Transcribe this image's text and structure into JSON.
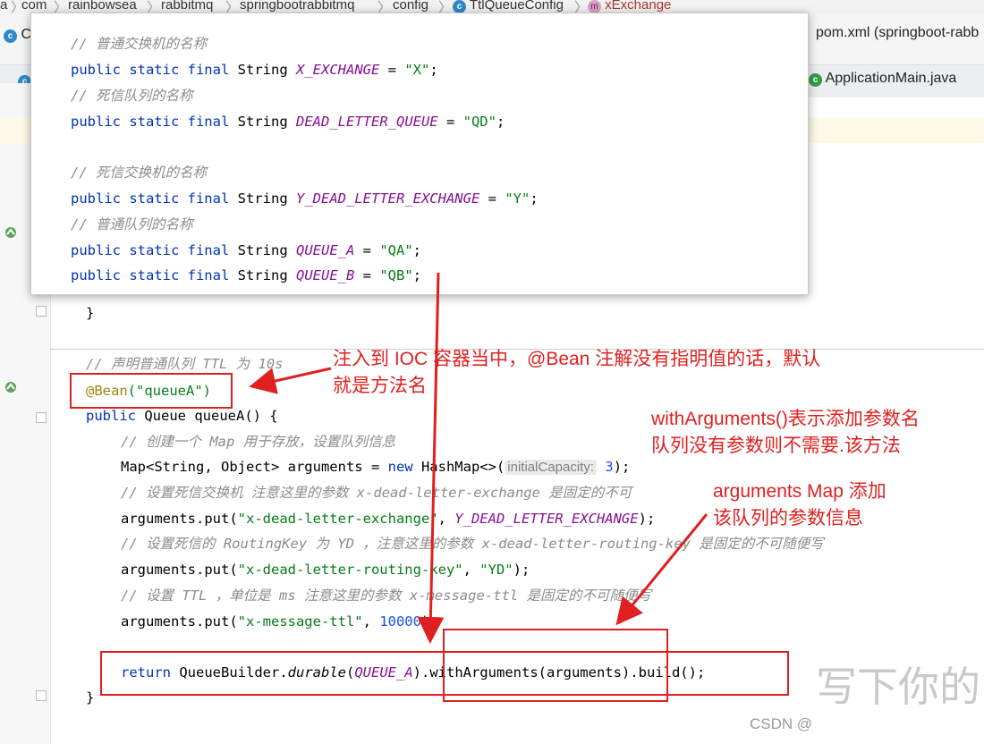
{
  "breadcrumb": [
    "a",
    "com",
    "rainbowsea",
    "rabbitmq",
    "springbootrabbitmq",
    "config",
    "TtlQueueConfig",
    "xExchange"
  ],
  "tabs": {
    "row1_left": "C",
    "row1_right": "pom.xml (springboot-rabb",
    "row2_right": "ApplicationMain.java"
  },
  "popup_lines": [
    {
      "comment": "// 普通交换机的名称"
    },
    {
      "kw": "public static final",
      "type": "String",
      "name": "X_EXCHANGE",
      "value": "\"X\""
    },
    {
      "comment": "// 死信队列的名称"
    },
    {
      "kw": "public static final",
      "type": "String",
      "name": "DEAD_LETTER_QUEUE",
      "value": "\"QD\""
    },
    {
      "comment": "// 死信交换机的名称"
    },
    {
      "kw": "public static final",
      "type": "String",
      "name": "Y_DEAD_LETTER_EXCHANGE",
      "value": "\"Y\""
    },
    {
      "comment": "// 普通队列的名称"
    },
    {
      "kw": "public static final",
      "type": "String",
      "name": "QUEUE_A",
      "value": "\"QA\""
    },
    {
      "kw": "public static final",
      "type": "String",
      "name": "QUEUE_B",
      "value": "\"QB\""
    }
  ],
  "code": {
    "close_brace": "}",
    "c_ttl": "// 声明普通队列 TTL 为 10s",
    "bean_ann": "@Bean",
    "bean_arg": "(\"queueA\")",
    "sig_kw": "public",
    "sig_rest": " Queue queueA() {",
    "c_map": "// 创建一个 Map 用于存放，设置队列信息",
    "map_decl": "Map<String, Object> arguments = ",
    "new_kw": "new",
    "hashmap": " HashMap<>(",
    "hint": "initialCapacity:",
    "three": "3",
    "map_end": ");",
    "c_dlx": "// 设置死信交换机 注意这里的参数 x-dead-letter-exchange 是固定的不可",
    "put1_pre": "arguments.put(",
    "put1_str": "\"x-dead-letter-exchange\"",
    "put1_const": "Y_DEAD_LETTER_EXCHANGE",
    "put_end": ");",
    "c_rk": "// 设置死信的 RoutingKey 为 YD ，注意这里的参数 x-dead-letter-routing-key 是固定的不可随便写",
    "put2_str": "\"x-dead-letter-routing-key\"",
    "put2_val": "\"YD\"",
    "c_ttl2": "// 设置 TTL ，单位是 ms 注意这里的参数 x-message-ttl 是固定的不可随便写",
    "put3_str": "\"x-message-ttl\"",
    "put3_num": "10000",
    "ret_kw": "return",
    "ret_builder": " QueueBuilder.",
    "ret_durable": "durable",
    "ret_const": "QUEUE_A",
    "ret_with": ".withArguments(arguments)",
    "ret_build": ".build();",
    "end_brace": "}"
  },
  "notes": {
    "bean_line1": "注入到 IOC 容器当中，@Bean 注解没有指明值的话，默认",
    "bean_line2": "就是方法名",
    "witharg_line1": "withArguments()表示添加参数名",
    "witharg_line2": "队列没有参数则不需要.该方法",
    "map_line1": "arguments Map 添加",
    "map_line2": "该队列的参数信息"
  },
  "watermark": {
    "csdn": "CSDN @",
    "big": "写下你的"
  },
  "colors": {
    "annotation_red": "#e02020",
    "keyword": "#0033b3",
    "string": "#067d17",
    "constant": "#871094",
    "comment": "#8c8c8c"
  }
}
